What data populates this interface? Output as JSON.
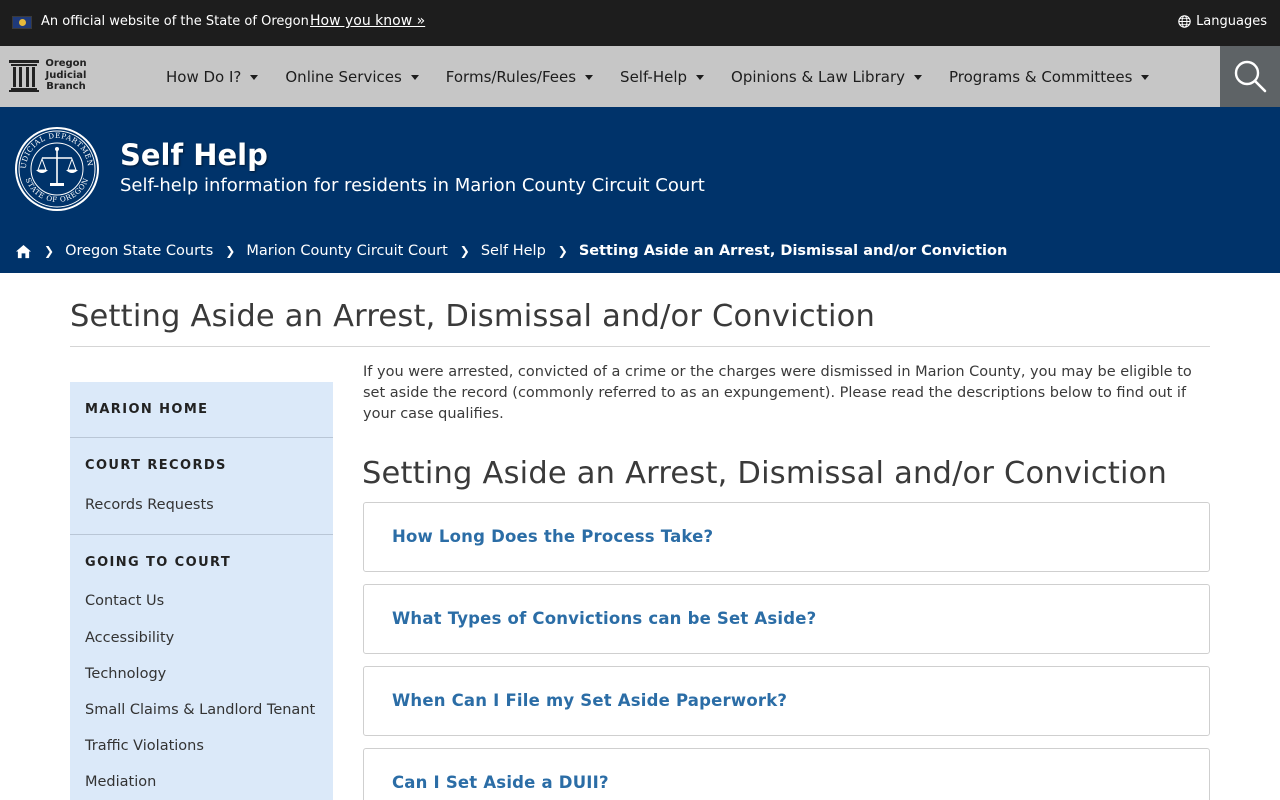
{
  "gov_banner": {
    "official_text": "An official website of the State of Oregon",
    "how_you_know": "How you know »",
    "languages": "Languages"
  },
  "logo": {
    "line1": "Oregon",
    "line2": "Judicial",
    "line3": "Branch"
  },
  "nav": {
    "items": [
      {
        "label": "How Do I?"
      },
      {
        "label": "Online Services"
      },
      {
        "label": "Forms/Rules/Fees"
      },
      {
        "label": "Self-Help"
      },
      {
        "label": "Opinions & Law Library"
      },
      {
        "label": "Programs & Committees"
      }
    ],
    "search_icon": "search-icon"
  },
  "hero": {
    "title": "Self Help",
    "subtitle": "Self-help information for residents in Marion County Circuit Court",
    "seal_text": "JUDICIAL DEPARTMENT · STATE OF OREGON"
  },
  "breadcrumb": {
    "items": [
      {
        "label": "Oregon State Courts"
      },
      {
        "label": "Marion County Circuit Court"
      },
      {
        "label": "Self Help"
      }
    ],
    "current": "Setting Aside an Arrest, Dismissal and/or Conviction"
  },
  "page": {
    "title": "Setting Aside an Arrest, Dismissal and/or Conviction",
    "intro": "If you were arrested, convicted of a crime or the charges were dismissed in Marion County, you may be eligible to set aside the record (commonly referred to as an expungement). Please read the descriptions below to find out if your case qualifies.",
    "section_title": "Setting Aside an Arrest, Dismissal and/or Conviction",
    "accordions": [
      {
        "label": "How Long Does the Process Take?"
      },
      {
        "label": "What Types of Convictions can be Set Aside?"
      },
      {
        "label": "When Can I File my Set Aside Paperwork?"
      },
      {
        "label": "Can I Set Aside a DUII?"
      }
    ]
  },
  "sidebar": {
    "marion_home": "MARION HOME",
    "court_records": "COURT RECORDS",
    "records_links": [
      "Records Requests"
    ],
    "going_to_court": "GOING TO COURT",
    "going_links": [
      "Contact Us",
      "Accessibility",
      "Technology",
      "Small Claims & Landlord Tenant",
      "Traffic Violations",
      "Mediation"
    ]
  },
  "colors": {
    "banner_bg": "#1d1d1d",
    "nav_bg": "#c6c6c6",
    "hero_bg": "#00336a",
    "sidebar_bg": "#dbe9f9",
    "accordion_link": "#2b6da6",
    "search_bg": "#5e6366"
  }
}
